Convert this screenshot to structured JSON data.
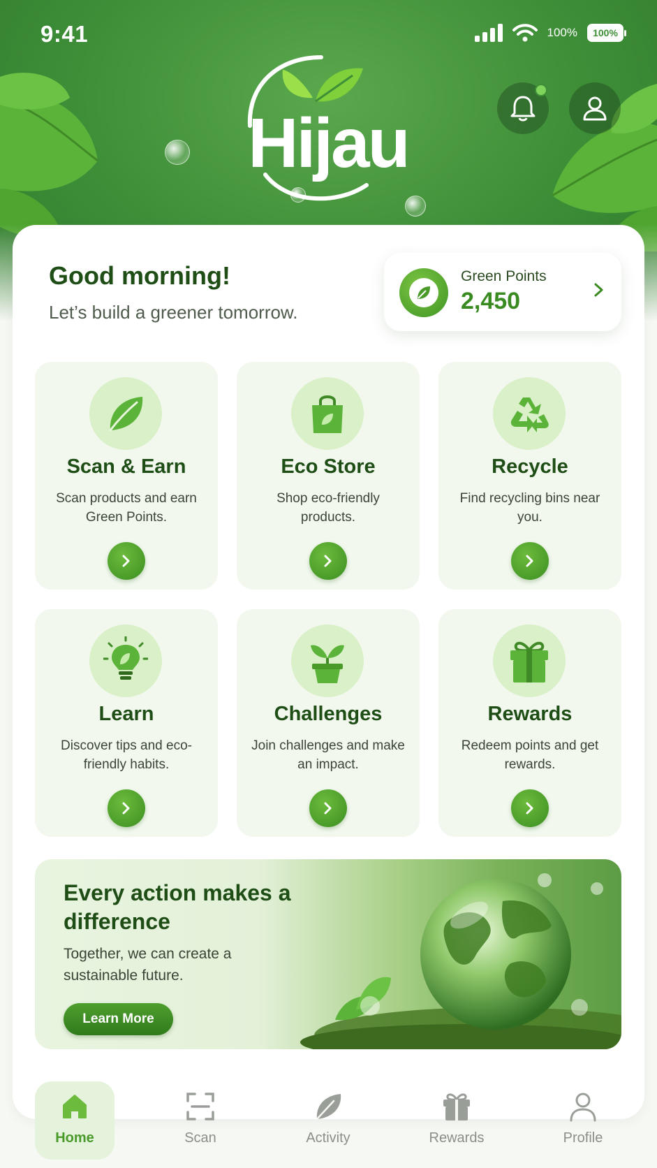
{
  "status_bar": {
    "time": "9:41",
    "signal_icon": "cellular-signal-icon",
    "wifi_icon": "wifi-icon",
    "battery_percent_text": "100%",
    "battery_label": "100%"
  },
  "header": {
    "app_name": "Hijau",
    "notification_icon": "bell-icon",
    "profile_icon": "user-icon",
    "has_unread_notification": true
  },
  "greeting": {
    "title": "Good morning!",
    "subtitle": "Let’s build a greener tomorrow."
  },
  "points": {
    "label": "Green Points",
    "value": "2,450",
    "icon": "leaf-coin-icon"
  },
  "tiles": [
    {
      "title": "Scan & Earn",
      "desc": "Scan products and earn Green Points.",
      "icon": "leaf-icon"
    },
    {
      "title": "Eco Store",
      "desc": "Shop eco-friendly products.",
      "icon": "shopping-bag-icon"
    },
    {
      "title": "Recycle",
      "desc": "Find recycling bins near you.",
      "icon": "recycle-icon"
    },
    {
      "title": "Learn",
      "desc": "Discover tips and eco-friendly habits.",
      "icon": "lightbulb-icon"
    },
    {
      "title": "Challenges",
      "desc": "Join challenges and make an impact.",
      "icon": "potted-plant-icon"
    },
    {
      "title": "Rewards",
      "desc": "Redeem points and get rewards.",
      "icon": "gift-icon"
    }
  ],
  "banner": {
    "title": "Every action makes a difference",
    "subtitle": "Together, we can create a sustainable future.",
    "button_label": "Learn More",
    "image": "glass-globe-on-moss"
  },
  "nav": {
    "items": [
      {
        "label": "Home",
        "icon": "home-icon",
        "active": true
      },
      {
        "label": "Scan",
        "icon": "scan-frame-icon",
        "active": false
      },
      {
        "label": "Activity",
        "icon": "leaf-icon",
        "active": false
      },
      {
        "label": "Rewards",
        "icon": "gift-icon",
        "active": false
      },
      {
        "label": "Profile",
        "icon": "user-icon",
        "active": false
      }
    ]
  },
  "colors": {
    "brand_green": "#3e8e38",
    "accent_green": "#4a9a2a",
    "tile_bg": "#f2f8ee",
    "icon_circle_bg": "#d9f0c8",
    "heading_dark": "#1e4d16"
  }
}
